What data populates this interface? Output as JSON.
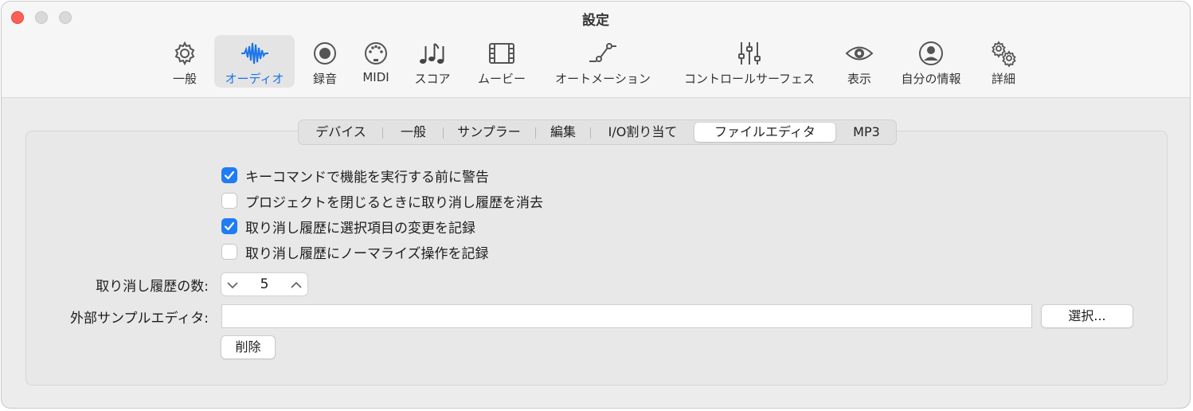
{
  "window": {
    "title": "設定"
  },
  "toolbar": {
    "items": [
      {
        "label": "一般",
        "icon": "gear-icon"
      },
      {
        "label": "オーディオ",
        "icon": "waveform-icon",
        "selected": true
      },
      {
        "label": "録音",
        "icon": "record-icon"
      },
      {
        "label": "MIDI",
        "icon": "midi-port-icon"
      },
      {
        "label": "スコア",
        "icon": "music-notes-icon"
      },
      {
        "label": "ムービー",
        "icon": "film-icon"
      },
      {
        "label": "オートメーション",
        "icon": "automation-curve-icon"
      },
      {
        "label": "コントロールサーフェス",
        "icon": "sliders-icon"
      },
      {
        "label": "表示",
        "icon": "eye-icon"
      },
      {
        "label": "自分の情報",
        "icon": "person-circle-icon"
      },
      {
        "label": "詳細",
        "icon": "gears-icon"
      }
    ],
    "accent_color": "#1a73e8"
  },
  "tabs": {
    "items": [
      "デバイス",
      "一般",
      "サンプラー",
      "編集",
      "I/O割り当て",
      "ファイルエディタ",
      "MP3"
    ],
    "active": "ファイルエディタ"
  },
  "options": {
    "checkboxes": [
      {
        "label": "キーコマンドで機能を実行する前に警告",
        "checked": true
      },
      {
        "label": "プロジェクトを閉じるときに取り消し履歴を消去",
        "checked": false
      },
      {
        "label": "取り消し履歴に選択項目の変更を記録",
        "checked": true
      },
      {
        "label": "取り消し履歴にノーマライズ操作を記録",
        "checked": false
      }
    ],
    "checkbox_color": "#1f7cf5"
  },
  "undo_history": {
    "label": "取り消し履歴の数:",
    "value": "5"
  },
  "external_editor": {
    "label": "外部サンプルエディタ:",
    "value": "",
    "choose_label": "選択...",
    "delete_label": "削除"
  }
}
